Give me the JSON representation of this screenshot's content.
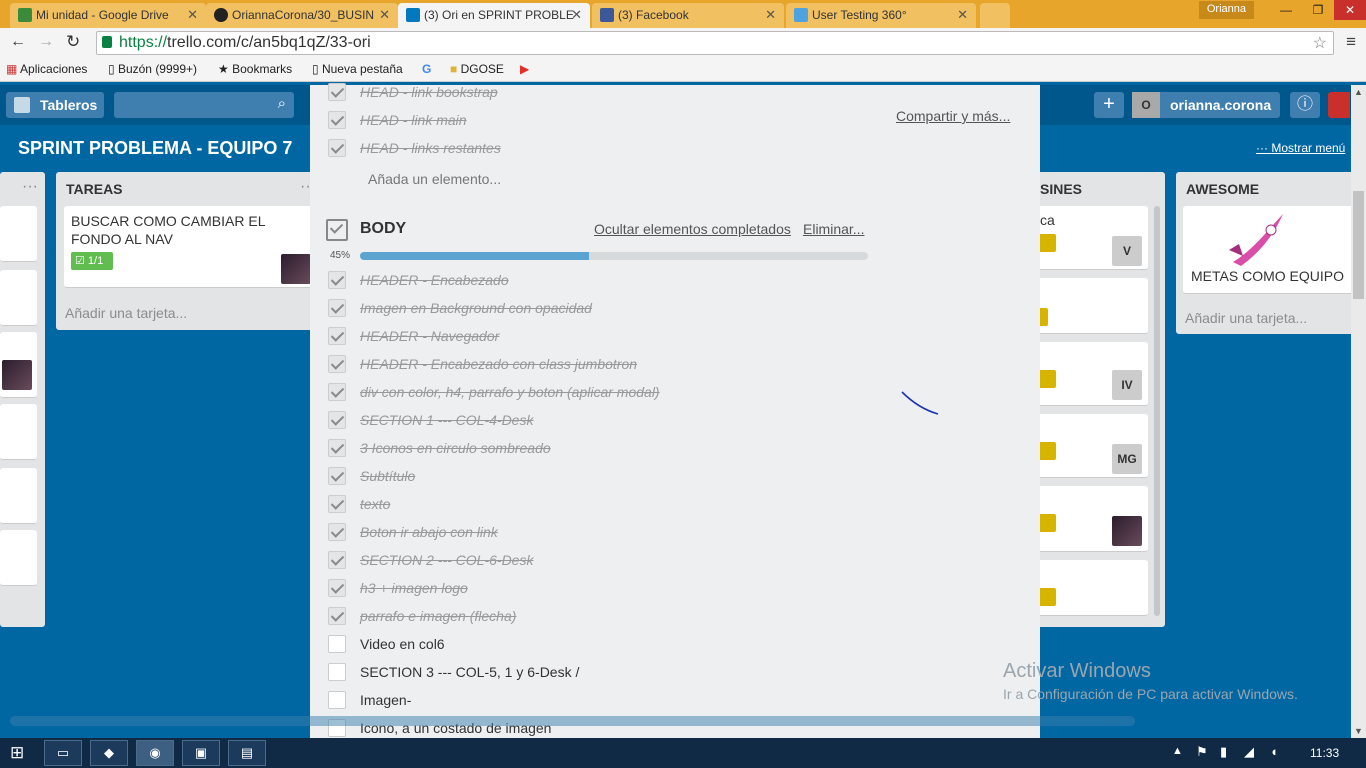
{
  "browser": {
    "tabs": [
      {
        "title": "Mi unidad - Google Drive",
        "icon": "google-drive-icon"
      },
      {
        "title": "OriannaCorona/30_BUSIN",
        "icon": "github-icon"
      },
      {
        "title": "(3) Ori en SPRINT PROBLE",
        "icon": "trello-icon"
      },
      {
        "title": "(3) Facebook",
        "icon": "facebook-icon"
      },
      {
        "title": "User Testing 360°",
        "icon": "check-icon"
      }
    ],
    "user": "Orianna",
    "url_scheme": "https://",
    "url_rest": "trello.com/c/an5bq1qZ/33-ori",
    "bookmarks": [
      "Aplicaciones",
      "Buzón (9999+)",
      "Bookmarks",
      "Nueva pestaña",
      "DGOSE"
    ]
  },
  "trello": {
    "boards_button": "Tableros",
    "user_initial": "O",
    "username": "orianna.corona",
    "board_title": "SPRINT PROBLEMA - EQUIPO 7",
    "show_menu": "Mostrar menú",
    "lists": {
      "tareas": {
        "title": "TAREAS",
        "card": "BUSCAR COMO CAMBIAR EL FONDO AL NAV",
        "badge": "1/1",
        "add": "Añadir una tarjeta..."
      },
      "busines": {
        "title_fragment": "SINES",
        "card_fragment": "ca",
        "badges": [
          "V",
          "IV",
          "MG"
        ]
      },
      "awesome": {
        "title": "AWESOME",
        "card": "METAS COMO EQUIPO",
        "add": "Añadir una tarjeta..."
      }
    }
  },
  "card_modal": {
    "share": "Compartir y más...",
    "head_items": [
      "HEAD - link bookstrap",
      "HEAD - link main",
      "HEAD - links restantes"
    ],
    "add_item": "Añada un elemento...",
    "checklist_title": "BODY",
    "hide_completed": "Ocultar elementos completados",
    "delete": "Eliminar...",
    "progress_label": "45%",
    "progress": 0.45,
    "body_items": [
      {
        "text": "HEADER - Encabezado",
        "done": true
      },
      {
        "text": "Imagen en Background con opacidad",
        "done": true
      },
      {
        "text": "HEADER - Navegador",
        "done": true
      },
      {
        "text": "HEADER - Encabezado con class jumbotron",
        "done": true
      },
      {
        "text": "div con color, h4, parrafo y boton (aplicar modal)",
        "done": true
      },
      {
        "text": "SECTION 1 --- COL-4-Desk",
        "done": true
      },
      {
        "text": "3 Iconos en circulo sombreado",
        "done": true
      },
      {
        "text": "Subtítulo",
        "done": true
      },
      {
        "text": "texto",
        "done": true
      },
      {
        "text": "Boton ir abajo con link",
        "done": true
      },
      {
        "text": "SECTION 2 --- COL-6-Desk",
        "done": true
      },
      {
        "text": "h3 + imagen logo",
        "done": true
      },
      {
        "text": "parrafo e imagen (flecha)",
        "done": true
      },
      {
        "text": "Video en col6",
        "done": false
      },
      {
        "text": "SECTION 3 --- COL-5, 1 y 6-Desk /",
        "done": false
      },
      {
        "text": "Imagen-",
        "done": false
      },
      {
        "text": "Icono, a un costado de imagen",
        "done": false
      }
    ]
  },
  "windows": {
    "activate_title": "Activar Windows",
    "activate_sub": "Ir a Configuración de PC para activar Windows.",
    "clock": "11:33"
  }
}
